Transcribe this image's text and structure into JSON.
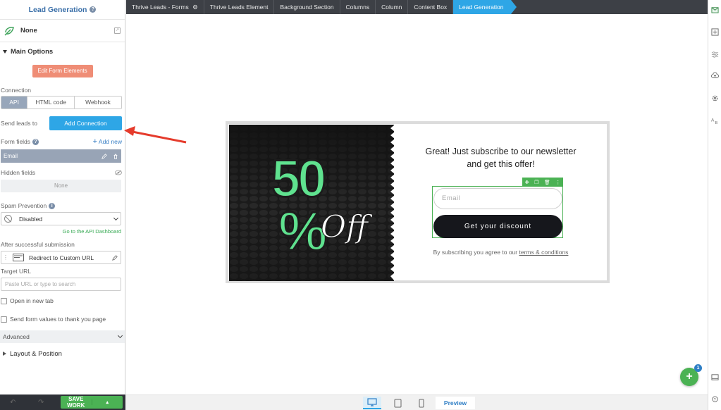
{
  "sidebar": {
    "title": "Lead Generation",
    "style_label": "None",
    "main_options_label": "Main Options",
    "edit_form_label": "Edit Form Elements",
    "connection_label": "Connection",
    "connection_tabs": [
      "API",
      "HTML code",
      "Webhook"
    ],
    "send_leads_label": "Send leads to",
    "add_connection_label": "Add Connection",
    "form_fields_label": "Form fields",
    "add_new_label": "Add new",
    "email_field_label": "Email",
    "hidden_fields_label": "Hidden fields",
    "hidden_none_label": "None",
    "spam_label": "Spam Prevention",
    "spam_value": "Disabled",
    "api_dashboard_link": "Go to the API Dashboard",
    "after_submit_label": "After successful submission",
    "after_submit_value": "Redirect to Custom URL",
    "target_url_label": "Target URL",
    "target_url_placeholder": "Paste URL or type to search",
    "open_new_tab_label": "Open in new tab",
    "send_form_values_label": "Send form values to thank you page",
    "advanced_label": "Advanced",
    "layout_label": "Layout & Position",
    "save_label": "SAVE WORK"
  },
  "breadcrumbs": [
    "Thrive Leads - Forms",
    "Thrive Leads Element",
    "Background Section",
    "Columns",
    "Column",
    "Content Box",
    "Lead Generation"
  ],
  "canvas": {
    "promo_big": "50",
    "promo_pct": "%",
    "promo_script": "Off",
    "headline_line1": "Great! Just subscribe to our newsletter",
    "headline_line2": "and get this offer!",
    "email_placeholder": "Email",
    "cta_label": "Get your discount",
    "disclaimer_prefix": "By subscribing you agree to our ",
    "disclaimer_link": "terms & conditions"
  },
  "bottom": {
    "preview_label": "Preview"
  },
  "fab": {
    "badge": "1"
  },
  "colors": {
    "accent_blue": "#2ea6e6",
    "green": "#4bb254",
    "salmon": "#ef8d76",
    "promo_green": "#5fe28f"
  }
}
